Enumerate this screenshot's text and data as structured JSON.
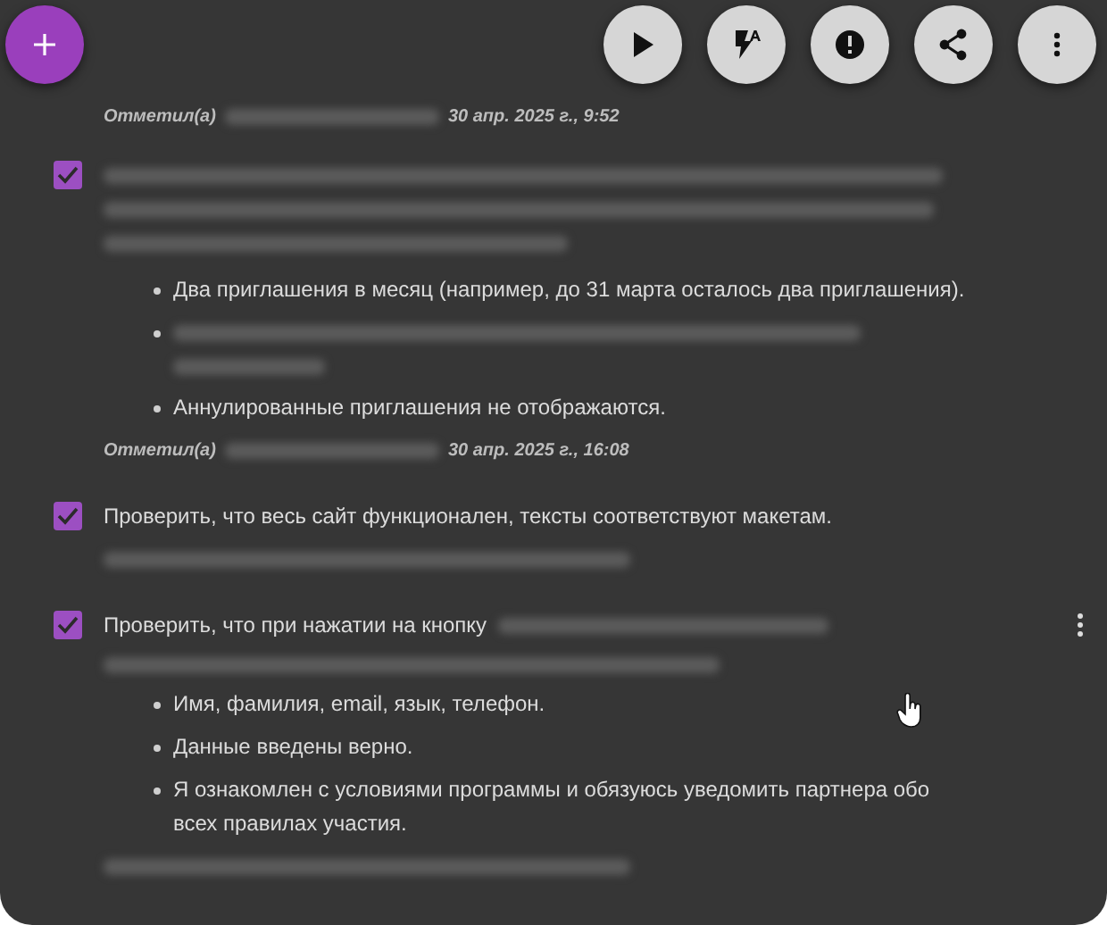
{
  "toolbar": {
    "actions": [
      {
        "kind": "play"
      },
      {
        "kind": "auto_flash"
      },
      {
        "kind": "alert"
      },
      {
        "kind": "share"
      },
      {
        "kind": "more"
      }
    ]
  },
  "top_meta": {
    "label": "Отметил(а)",
    "date": "30 апр. 2025 г., 9:52"
  },
  "items": [
    {
      "checked": true,
      "menu": false,
      "title": [
        {
          "kind": "blurred_paragraph"
        }
      ],
      "bullets": [
        {
          "kind": "text",
          "text": "Два приглашения в месяц (например, до 31 марта осталось два приглашения)."
        },
        {
          "kind": "blurred_pair"
        },
        {
          "kind": "text",
          "text": "Аннулированные приглашения не отображаются."
        }
      ],
      "meta": {
        "kind": "signed",
        "label": "Отметил(а)",
        "date": "30 апр. 2025 г., 16:08"
      }
    },
    {
      "checked": true,
      "menu": false,
      "title": [
        {
          "kind": "text",
          "text": "Проверить, что весь сайт функционален, тексты соответствуют макетам."
        }
      ],
      "meta": {
        "kind": "blurred"
      }
    },
    {
      "checked": true,
      "menu": true,
      "title": [
        {
          "kind": "text",
          "text": "Проверить, что при нажатии на кнопку"
        },
        {
          "kind": "blurred_tail"
        }
      ],
      "bullets": [
        {
          "kind": "text",
          "text": "Имя, фамилия, email, язык, телефон."
        },
        {
          "kind": "text",
          "text": "Данные введены верно."
        },
        {
          "kind": "text",
          "text": "Я ознакомлен с условиями программы и обязуюсь уведомить партнера обо всех правилах участия."
        }
      ],
      "meta": {
        "kind": "blurred"
      }
    }
  ]
}
